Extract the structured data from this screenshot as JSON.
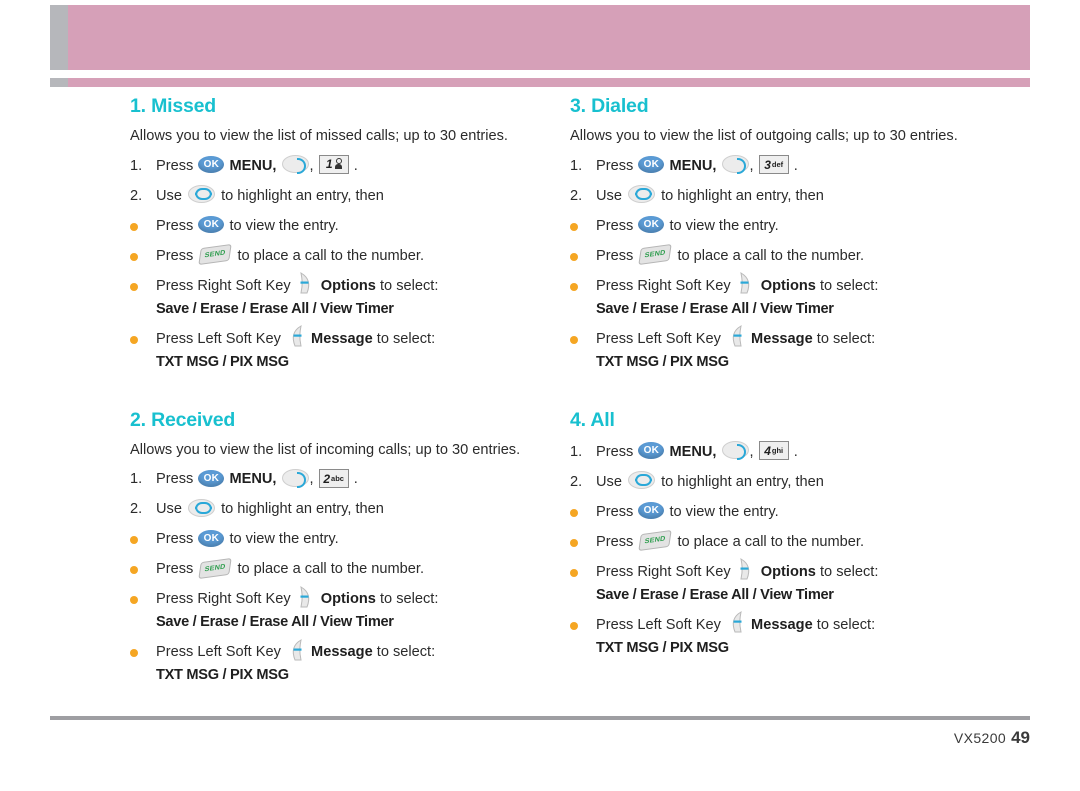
{
  "document": {
    "footer_model": "VX5200",
    "footer_page": "49",
    "colors": {
      "heading": "#18c0cf",
      "banner_pink": "#d6a0b8",
      "banner_gray": "#b6b7bb",
      "bullet": "#f5a623",
      "ok_key": "#5b9bd5",
      "send_text": "#2f9e4f"
    }
  },
  "sections": [
    {
      "title": "1. Missed",
      "intro": "Allows you to view the list of missed calls; up to 30 entries.",
      "steps": [
        {
          "num": "1.",
          "pre": "Press",
          "keys": [
            "ok"
          ],
          "mid": "MENU,",
          "keys2": [
            "right"
          ],
          "comma": ",",
          "keys3": [
            "key1"
          ],
          "post": "."
        },
        {
          "num": "2.",
          "pre": "Use",
          "keys": [
            "updown"
          ],
          "post": "to highlight an entry, then"
        }
      ],
      "bullets": [
        {
          "pre": "Press",
          "icon": "ok",
          "post": "to view the entry."
        },
        {
          "pre": "Press",
          "icon": "send",
          "post": "to place a call to the number."
        },
        {
          "pre": "Press Right Soft Key",
          "icon": "softright",
          "bold": "Options",
          "post": "to select:",
          "sub": "Save / Erase / Erase All / View Timer"
        },
        {
          "pre": "Press Left Soft Key",
          "icon": "softleft",
          "bold": "Message",
          "post": "to select:",
          "sub": "TXT MSG / PIX MSG"
        }
      ]
    },
    {
      "title": "2. Received",
      "intro": "Allows you to view the list of incoming calls; up to 30 entries.",
      "steps": [
        {
          "num": "1.",
          "pre": "Press",
          "keys": [
            "ok"
          ],
          "mid": "MENU,",
          "keys2": [
            "right"
          ],
          "comma": ",",
          "keys3": [
            "key2"
          ],
          "post": "."
        },
        {
          "num": "2.",
          "pre": "Use",
          "keys": [
            "updown"
          ],
          "post": "to highlight an entry, then"
        }
      ],
      "bullets": [
        {
          "pre": "Press",
          "icon": "ok",
          "post": "to view the entry."
        },
        {
          "pre": "Press",
          "icon": "send",
          "post": "to place a call to the number."
        },
        {
          "pre": "Press Right Soft Key",
          "icon": "softright",
          "bold": "Options",
          "post": "to select:",
          "sub": "Save / Erase / Erase All / View Timer"
        },
        {
          "pre": "Press Left Soft Key",
          "icon": "softleft",
          "bold": "Message",
          "post": "to select:",
          "sub": "TXT MSG / PIX MSG"
        }
      ]
    },
    {
      "title": "3. Dialed",
      "intro": "Allows you to view the list of outgoing calls; up to 30 entries.",
      "steps": [
        {
          "num": "1.",
          "pre": "Press",
          "keys": [
            "ok"
          ],
          "mid": "MENU,",
          "keys2": [
            "right"
          ],
          "comma": ",",
          "keys3": [
            "key3"
          ],
          "post": "."
        },
        {
          "num": "2.",
          "pre": "Use",
          "keys": [
            "updown"
          ],
          "post": "to highlight an entry, then"
        }
      ],
      "bullets": [
        {
          "pre": "Press",
          "icon": "ok",
          "post": "to view the entry."
        },
        {
          "pre": "Press",
          "icon": "send",
          "post": "to place a call to the number."
        },
        {
          "pre": "Press Right Soft Key",
          "icon": "softright",
          "bold": "Options",
          "post": "to select:",
          "sub": "Save / Erase / Erase All / View Timer"
        },
        {
          "pre": "Press Left Soft Key",
          "icon": "softleft",
          "bold": "Message",
          "post": "to select:",
          "sub": "TXT MSG / PIX MSG"
        }
      ]
    },
    {
      "title": "4. All",
      "intro": "",
      "steps": [
        {
          "num": "1.",
          "pre": "Press",
          "keys": [
            "ok"
          ],
          "mid": "MENU,",
          "keys2": [
            "right"
          ],
          "comma": ",",
          "keys3": [
            "key4"
          ],
          "post": "."
        },
        {
          "num": "2.",
          "pre": "Use",
          "keys": [
            "updown"
          ],
          "post": "to highlight an entry, then"
        }
      ],
      "bullets": [
        {
          "pre": "Press",
          "icon": "ok",
          "post": "to view the entry."
        },
        {
          "pre": "Press",
          "icon": "send",
          "post": "to place a call to the number."
        },
        {
          "pre": "Press Right Soft Key",
          "icon": "softright",
          "bold": "Options",
          "post": "to select:",
          "sub": "Save / Erase / Erase All / View Timer"
        },
        {
          "pre": "Press Left Soft Key",
          "icon": "softleft",
          "bold": "Message",
          "post": "to select:",
          "sub": "TXT MSG / PIX MSG"
        }
      ]
    }
  ],
  "keys": {
    "ok": {
      "label": "OK"
    },
    "send": {
      "label": "SEND"
    },
    "key1": {
      "digit": "1",
      "letters": ""
    },
    "key2": {
      "digit": "2",
      "letters": "abc"
    },
    "key3": {
      "digit": "3",
      "letters": "def"
    },
    "key4": {
      "digit": "4",
      "letters": "ghi"
    }
  }
}
